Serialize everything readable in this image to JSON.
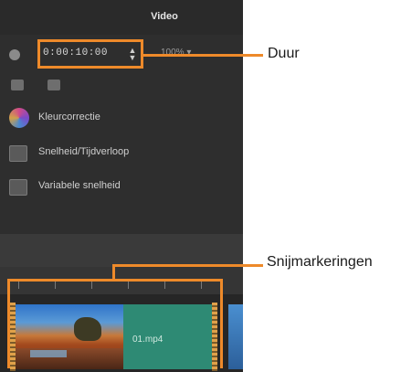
{
  "panel": {
    "title": "Video",
    "duration_timecode": "0:00:10:00",
    "duration_spinner": "▲\n▼",
    "zoom_dropdown": "100% ▾",
    "features": [
      {
        "label": "Kleurcorrectie",
        "icon": "color-wheel-icon"
      },
      {
        "label": "Snelheid/Tijdverloop",
        "icon": "speed-icon"
      },
      {
        "label": "Variabele snelheid",
        "icon": "variable-speed-icon"
      }
    ],
    "clip_name": "01.mp4"
  },
  "callouts": {
    "duration": "Duur",
    "trim_markers": "Snijmarkeringen"
  },
  "colors": {
    "accent": "#ee8a2a",
    "panel_bg": "#2e2e2e",
    "clip_green": "#2e8a74"
  }
}
